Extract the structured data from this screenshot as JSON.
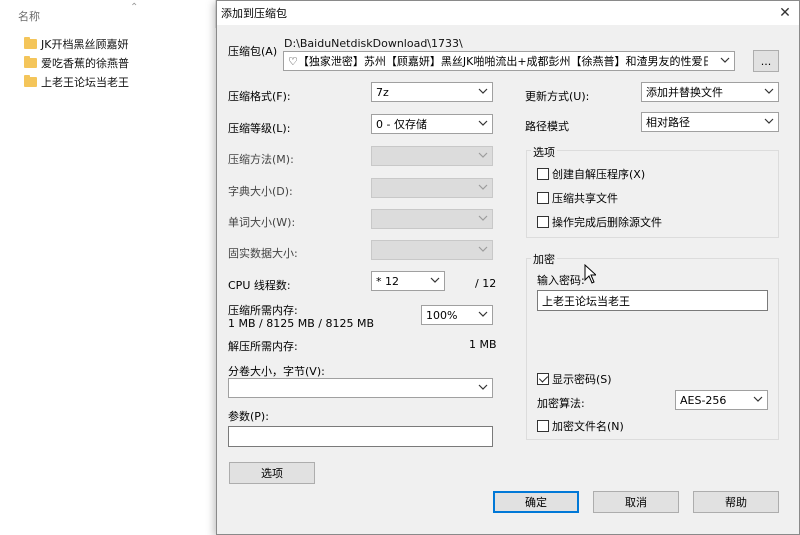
{
  "explorer": {
    "column_header": "名称",
    "sort_icon": "chevron-up-icon",
    "items": [
      {
        "name": "JK开档黑丝顾嘉妍",
        "icon": "folder-icon"
      },
      {
        "name": "爱吃香蕉的徐燕普",
        "icon": "folder-icon"
      },
      {
        "name": "上老王论坛当老王",
        "icon": "folder-icon"
      }
    ]
  },
  "dialog": {
    "title": "添加到压缩包",
    "close_icon": "close-icon",
    "archive": {
      "label": "压缩包(A)",
      "path": "D:\\BaiduNetdiskDownload\\1733\\",
      "value": "♡【独家泄密】苏州【顾嘉妍】黑丝JK啪啪流出+成都彭州【徐燕普】和渣男友的性爱日记",
      "browse_label": "..."
    },
    "format": {
      "label": "压缩格式(F):",
      "value": "7z"
    },
    "level": {
      "label": "压缩等级(L):",
      "value": "0 - 仅存储"
    },
    "method": {
      "label": "压缩方法(M):",
      "value": ""
    },
    "dict": {
      "label": "字典大小(D):",
      "value": ""
    },
    "word": {
      "label": "单词大小(W):",
      "value": ""
    },
    "solid": {
      "label": "固实数据大小:",
      "value": ""
    },
    "cpu": {
      "label": "CPU 线程数:",
      "value": "* 12",
      "max": "/ 12"
    },
    "mem_compress": {
      "label": "压缩所需内存:",
      "detail": "1 MB / 8125 MB / 8125 MB",
      "percent": "100%"
    },
    "mem_decompress": {
      "label": "解压所需内存:",
      "value": "1 MB"
    },
    "volume": {
      "label": "分卷大小，字节(V):",
      "value": ""
    },
    "params": {
      "label": "参数(P):",
      "value": ""
    },
    "options_button": "选项",
    "update": {
      "label": "更新方式(U):",
      "value": "添加并替换文件"
    },
    "path_mode": {
      "label": "路径模式",
      "value": "相对路径"
    },
    "options_group": {
      "title": "选项",
      "items": [
        {
          "label": "创建自解压程序(X)",
          "checked": false
        },
        {
          "label": "压缩共享文件",
          "checked": false
        },
        {
          "label": "操作完成后删除源文件",
          "checked": false
        }
      ]
    },
    "encryption": {
      "title": "加密",
      "password_label": "输入密码:",
      "password_value": "上老王论坛当老王",
      "show_password": {
        "label": "显示密码(S)",
        "checked": true
      },
      "algorithm_label": "加密算法:",
      "algorithm_value": "AES-256",
      "encrypt_names": {
        "label": "加密文件名(N)",
        "checked": false
      }
    },
    "buttons": {
      "ok": "确定",
      "cancel": "取消",
      "help": "帮助"
    }
  }
}
